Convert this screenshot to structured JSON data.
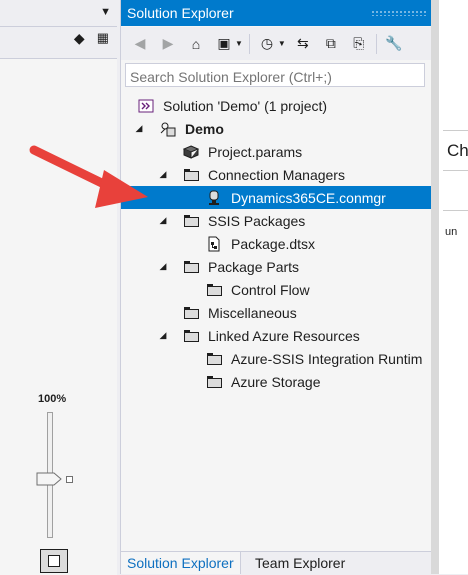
{
  "left_pane": {
    "zoom": "100%"
  },
  "solution_explorer": {
    "title": "Solution Explorer",
    "search_placeholder": "Search Solution Explorer (Ctrl+;)",
    "tree": [
      {
        "label": "Solution 'Demo' (1 project)",
        "icon": "visual-studio-solution-icon"
      },
      {
        "label": "Demo",
        "icon": "ssis-project-icon"
      },
      {
        "label": "Project.params",
        "icon": "params-icon"
      },
      {
        "label": "Connection Managers",
        "icon": "folder-icon"
      },
      {
        "label": "Dynamics365CE.conmgr",
        "icon": "connection-manager-icon"
      },
      {
        "label": "SSIS Packages",
        "icon": "folder-icon"
      },
      {
        "label": "Package.dtsx",
        "icon": "package-icon"
      },
      {
        "label": "Package Parts",
        "icon": "folder-icon"
      },
      {
        "label": "Control Flow",
        "icon": "folder-icon"
      },
      {
        "label": "Miscellaneous",
        "icon": "folder-icon"
      },
      {
        "label": "Linked Azure Resources",
        "icon": "folder-icon"
      },
      {
        "label": "Azure-SSIS Integration Runtim",
        "icon": "folder-icon"
      },
      {
        "label": "Azure Storage",
        "icon": "folder-icon"
      }
    ],
    "tabs": [
      {
        "label": "Solution Explorer"
      },
      {
        "label": "Team Explorer"
      }
    ]
  },
  "right_pane": {
    "fragment_1": "Ch",
    "fragment_2": "un"
  },
  "colors": {
    "accent": "#007acc",
    "annotation_arrow": "#e8413b"
  }
}
